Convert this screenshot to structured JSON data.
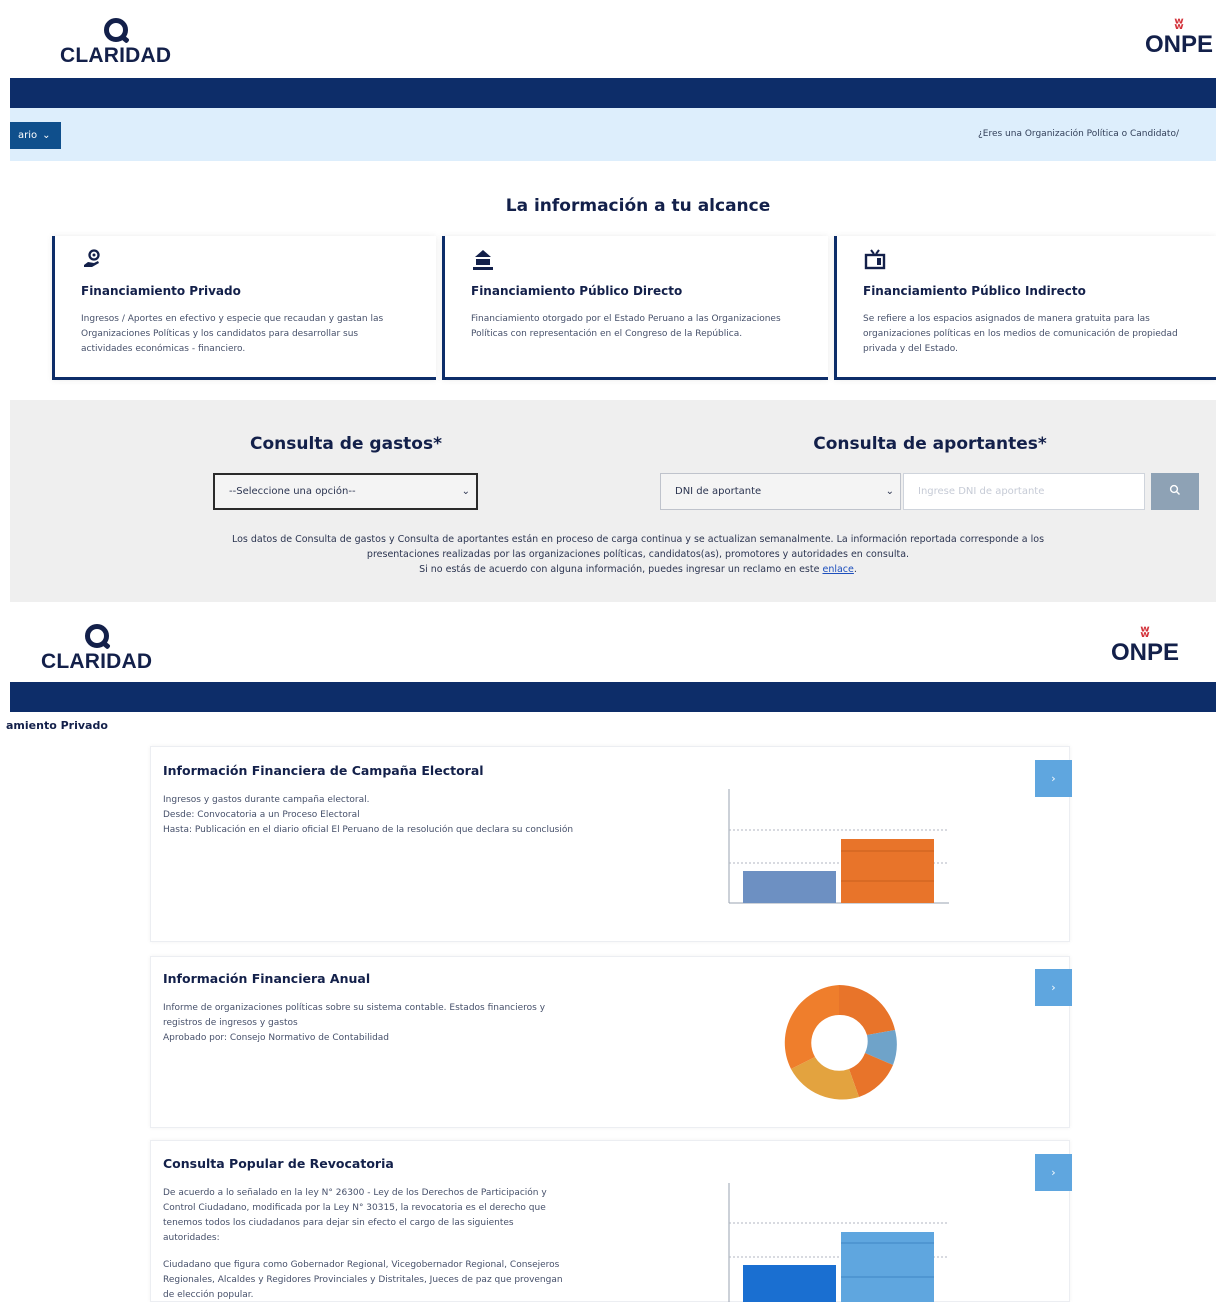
{
  "header_top": {
    "claridad_logo": "CLARIDAD",
    "onpe_logo": "ONPE"
  },
  "subbar": {
    "menu_label": "ario",
    "link_text": "¿Eres una Organización Política o Candidato/"
  },
  "info_section": {
    "title": "La información a tu alcance",
    "cards": [
      {
        "title": "Financiamiento Privado",
        "desc": "Ingresos / Aportes en efectivo y especie que recaudan y gastan las Organizaciones Políticas y los candidatos para desarrollar sus actividades económicas - financiero."
      },
      {
        "title": "Financiamiento Público Directo",
        "desc": "Financiamiento otorgado por el Estado Peruano a las Organizaciones Políticas con representación en el Congreso de la República."
      },
      {
        "title": "Financiamiento Público Indirecto",
        "desc": "Se refiere a los espacios asignados de manera gratuita para las organizaciones políticas en los medios de comunicación de propiedad privada y del Estado."
      }
    ]
  },
  "consulta": {
    "gastos_title": "Consulta de gastos*",
    "gastos_select": "--Seleccione una opción--",
    "aportantes_title": "Consulta de aportantes*",
    "aportantes_select": "DNI de aportante",
    "aportantes_placeholder": "Ingrese DNI de aportante",
    "notice_line1": "Los datos de Consulta de gastos y Consulta de aportantes están en proceso de carga continua y se actualizan semanalmente. La información reportada corresponde a los",
    "notice_line2": "presentaciones realizadas por las organizaciones políticas, candidatos(as), promotores y autoridades en consulta.",
    "notice_line3": "Si no estás de acuerdo con alguna información, puedes ingresar un reclamo en este",
    "notice_link": "enlace",
    "notice_end": "."
  },
  "header_bottom": {
    "claridad_logo": "CLARIDAD",
    "onpe_logo": "ONPE"
  },
  "breadcrumb": "amiento Privado",
  "detail_cards": [
    {
      "title": "Información Financiera de Campaña Electoral",
      "lines": [
        "Ingresos y gastos durante campaña electoral.",
        "Desde: Convocatoria a un Proceso Electoral",
        "Hasta: Publicación en el diario oficial El Peruano de la resolución que declara su conclusión"
      ]
    },
    {
      "title": "Información Financiera Anual",
      "lines": [
        "Informe de organizaciones políticas sobre su sistema contable. Estados financieros y registros de ingresos y gastos",
        "Aprobado por: Consejo Normativo de Contabilidad"
      ]
    },
    {
      "title": "Consulta Popular de Revocatoria",
      "para1": "De acuerdo a lo señalado en la ley N° 26300 - Ley de los Derechos de Participación y Control Ciudadano, modificada por la Ley N° 30315, la revocatoria es el derecho que tenemos todos los ciudadanos para dejar sin efecto el cargo de las siguientes autoridades:",
      "para2": "Ciudadano que figura como Gobernador Regional, Vicegobernador Regional, Consejeros Regionales, Alcaldes y Regidores Provinciales y Distritales, Jueces de paz que provengan de elección popular."
    }
  ],
  "colors": {
    "navy": "#0d2d69",
    "light_blue_band": "#ddeefc",
    "accent_button": "#5fa6df",
    "orange": "#e8742a",
    "steel_blue": "#6d90c2"
  },
  "icons": {
    "card1": "hand-coin-icon",
    "card2": "government-building-icon",
    "card3": "television-icon",
    "search": "search-icon",
    "chevron": "chevron-down-icon",
    "arrow": "chevron-right-icon"
  }
}
